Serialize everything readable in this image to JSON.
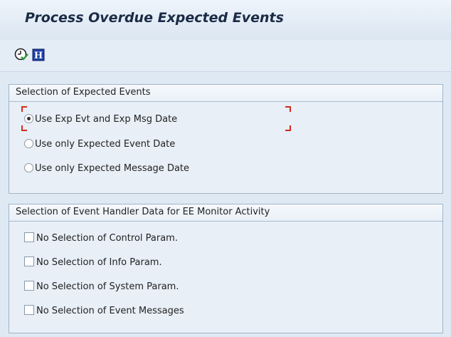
{
  "window": {
    "title": "Process Overdue Expected Events"
  },
  "toolbar": {
    "execute_icon": "clock-execute-icon",
    "info_icon": "info-icon",
    "info_glyph": "H"
  },
  "expected_events_group": {
    "header": "Selection of Expected Events",
    "options": [
      {
        "label": "Use Exp Evt and Exp Msg Date",
        "selected": true
      },
      {
        "label": "Use only Expected Event Date",
        "selected": false
      },
      {
        "label": "Use only Expected Message Date",
        "selected": false
      }
    ]
  },
  "event_handler_group": {
    "header": "Selection of Event Handler Data for EE Monitor Activity",
    "options": [
      {
        "label": "No Selection of Control Param.",
        "checked": false
      },
      {
        "label": "No Selection of Info Param.",
        "checked": false
      },
      {
        "label": "No Selection of System Param.",
        "checked": false
      },
      {
        "label": "No Selection of Event Messages",
        "checked": false
      }
    ]
  },
  "colors": {
    "background": "#dfe9f4",
    "title_text": "#1a2b45",
    "focus_marker": "#d32a1e",
    "info_icon_bg": "#1d3fa8"
  }
}
